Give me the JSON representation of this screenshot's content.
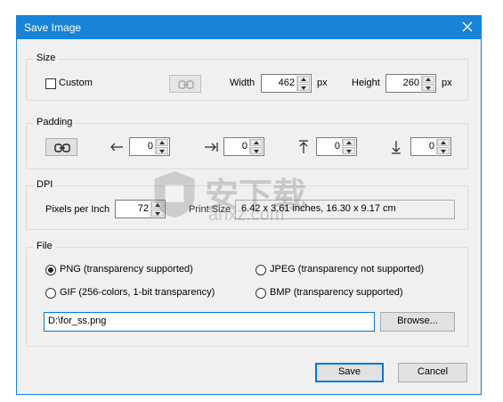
{
  "window": {
    "title": "Save Image",
    "accent": "#1883d7"
  },
  "size": {
    "group_label": "Size",
    "custom_label": "Custom",
    "custom_checked": false,
    "width_label": "Width",
    "width_value": "462",
    "width_unit": "px",
    "height_label": "Height",
    "height_value": "260",
    "height_unit": "px"
  },
  "padding": {
    "group_label": "Padding",
    "left_value": "0",
    "right_value": "0",
    "top_value": "0",
    "bottom_value": "0"
  },
  "dpi": {
    "group_label": "DPI",
    "ppi_label": "Pixels per Inch",
    "ppi_value": "72",
    "print_size_label": "Print Size",
    "print_size_value": "6.42 x 3.61 inches, 16.30 x 9.17 cm"
  },
  "file": {
    "group_label": "File",
    "formats": [
      {
        "label": "PNG (transparency supported)",
        "selected": true
      },
      {
        "label": "JPEG (transparency not supported)",
        "selected": false
      },
      {
        "label": "GIF (256-colors, 1-bit transparency)",
        "selected": false
      },
      {
        "label": "BMP (transparency supported)",
        "selected": false
      }
    ],
    "path_value": "D:\\for_ss.png",
    "browse_label": "Browse..."
  },
  "buttons": {
    "save": "Save",
    "cancel": "Cancel"
  },
  "watermark": {
    "text": "安下载",
    "subtext": "anxz.com"
  }
}
